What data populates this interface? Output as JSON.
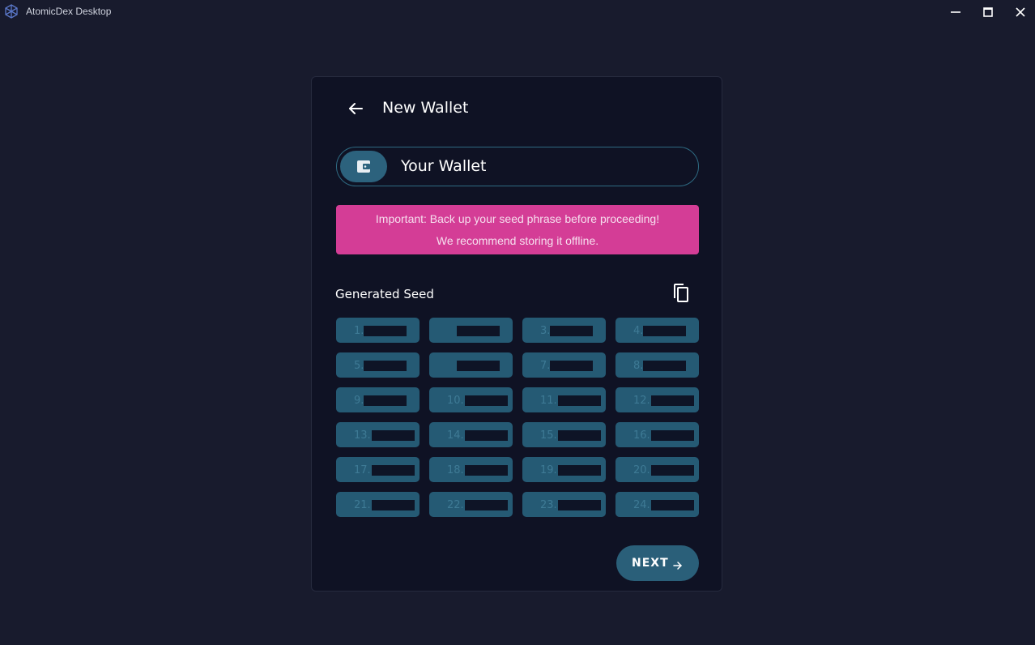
{
  "window": {
    "title": "AtomicDex Desktop",
    "icons": [
      "app-logo-icon",
      "minimize-icon",
      "maximize-icon",
      "close-icon"
    ]
  },
  "page": {
    "title": "New Wallet",
    "back_icon": "arrow-left-icon"
  },
  "wallet": {
    "name": "Your Wallet",
    "icon": "wallet-icon"
  },
  "warning": {
    "line1": "Important: Back up your seed phrase before proceeding!",
    "line2": "We recommend storing it offline."
  },
  "seed": {
    "label": "Generated Seed",
    "copy_icon": "copy-icon",
    "words": [
      {
        "num": "1."
      },
      {
        "num": "2."
      },
      {
        "num": "3."
      },
      {
        "num": "4."
      },
      {
        "num": "5."
      },
      {
        "num": "6."
      },
      {
        "num": "7."
      },
      {
        "num": "8."
      },
      {
        "num": "9."
      },
      {
        "num": "10."
      },
      {
        "num": "11."
      },
      {
        "num": "12."
      },
      {
        "num": "13."
      },
      {
        "num": "14."
      },
      {
        "num": "15."
      },
      {
        "num": "16."
      },
      {
        "num": "17."
      },
      {
        "num": "18."
      },
      {
        "num": "19."
      },
      {
        "num": "20."
      },
      {
        "num": "21."
      },
      {
        "num": "22."
      },
      {
        "num": "23."
      },
      {
        "num": "24."
      }
    ]
  },
  "actions": {
    "next_label": "NEXT",
    "next_icon": "arrow-right-icon"
  },
  "colors": {
    "background": "#181b2d",
    "card": "#0f1224",
    "accent": "#2c627d",
    "warning": "#d43d96"
  }
}
